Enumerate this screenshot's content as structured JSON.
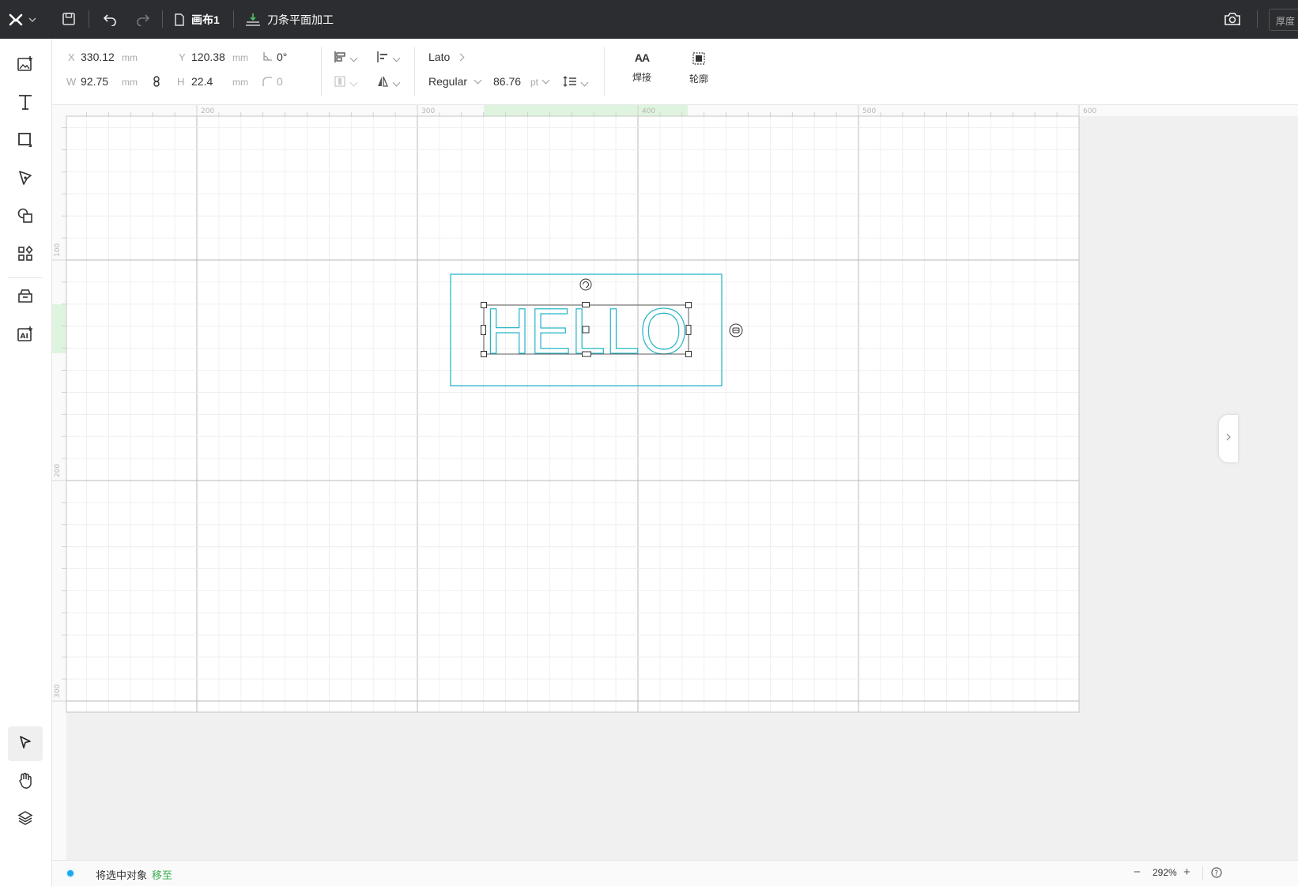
{
  "titlebar": {
    "file_name": "画布1",
    "mode_label": "刀条平面加工",
    "thickness_label": "厚度"
  },
  "propbar": {
    "x_label": "X",
    "x_value": "330.12",
    "x_unit": "mm",
    "y_label": "Y",
    "y_value": "120.38",
    "y_unit": "mm",
    "angle_value": "0°",
    "w_label": "W",
    "w_value": "92.75",
    "w_unit": "mm",
    "h_label": "H",
    "h_value": "22.4",
    "h_unit": "mm",
    "corner_value": "0",
    "font_family": "Lato",
    "font_style": "Regular",
    "font_size": "86.76",
    "font_size_unit": "pt",
    "weld_label": "焊接",
    "weld_icon_text": "AA",
    "outline_label": "轮廓"
  },
  "canvas": {
    "text": "HELLO",
    "ruler_top": [
      "200",
      "300",
      "400",
      "500",
      "600"
    ],
    "ruler_left": [
      "100",
      "200",
      "300"
    ],
    "colors": {
      "selection": "#2ab7c8",
      "ruler_highlight": "#dff4df",
      "grid_major": "#b8b8b8",
      "grid_minor": "#ececec"
    }
  },
  "status": {
    "prefix": "将选中对象",
    "action": "移至",
    "zoom": "292%"
  }
}
